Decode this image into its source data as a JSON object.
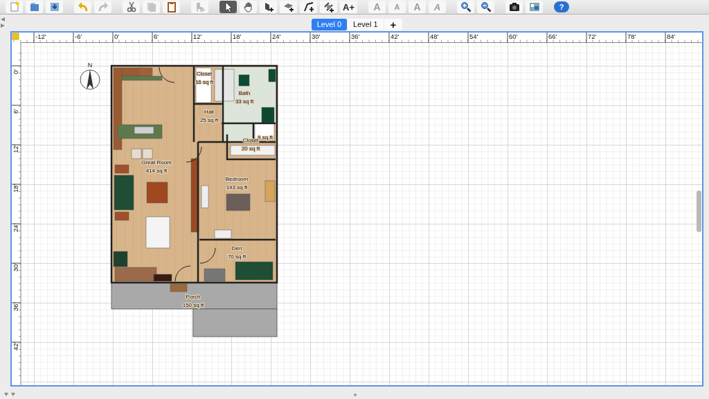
{
  "toolbar": {
    "groups": [
      {
        "buttons": [
          {
            "kind": "new",
            "disabled": false,
            "selected": false
          },
          {
            "kind": "open",
            "disabled": false,
            "selected": false
          },
          {
            "kind": "save",
            "disabled": false,
            "selected": false
          }
        ]
      },
      {
        "buttons": [
          {
            "kind": "undo",
            "disabled": false,
            "selected": false
          },
          {
            "kind": "redo",
            "disabled": true,
            "selected": false
          }
        ]
      },
      {
        "buttons": [
          {
            "kind": "cut",
            "disabled": false,
            "selected": false
          },
          {
            "kind": "copy",
            "disabled": true,
            "selected": false
          },
          {
            "kind": "paste",
            "disabled": false,
            "selected": false
          }
        ]
      },
      {
        "buttons": [
          {
            "kind": "add-furniture",
            "disabled": true,
            "selected": false
          }
        ]
      },
      {
        "buttons": [
          {
            "kind": "select",
            "disabled": false,
            "selected": true
          },
          {
            "kind": "pan",
            "disabled": false,
            "selected": false
          },
          {
            "kind": "walls",
            "disabled": false,
            "selected": false
          },
          {
            "kind": "rooms",
            "disabled": false,
            "selected": false
          },
          {
            "kind": "polylines",
            "disabled": false,
            "selected": false
          },
          {
            "kind": "dimensions",
            "disabled": false,
            "selected": false
          },
          {
            "kind": "add-text",
            "label": "A+",
            "disabled": false,
            "selected": false
          }
        ]
      },
      {
        "buttons": [
          {
            "kind": "bigger-text",
            "label": "A",
            "disabled": true,
            "selected": false
          },
          {
            "kind": "smaller-text",
            "label": "A",
            "disabled": true,
            "selected": false
          },
          {
            "kind": "bold-text",
            "label": "A",
            "disabled": true,
            "selected": false
          },
          {
            "kind": "italic-text",
            "label": "A",
            "disabled": true,
            "selected": false
          }
        ]
      },
      {
        "buttons": [
          {
            "kind": "zoom-in",
            "disabled": false,
            "selected": false
          },
          {
            "kind": "zoom-out",
            "disabled": false,
            "selected": false
          }
        ]
      },
      {
        "buttons": [
          {
            "kind": "photo",
            "disabled": false,
            "selected": false
          },
          {
            "kind": "video",
            "disabled": false,
            "selected": false
          }
        ]
      },
      {
        "buttons": [
          {
            "kind": "help",
            "label": "?",
            "disabled": false,
            "selected": false
          }
        ]
      }
    ]
  },
  "tabs": [
    {
      "label": "Level 0",
      "selected": true
    },
    {
      "label": "Level 1",
      "selected": false
    }
  ],
  "add_level": "+",
  "plan": {
    "ruler_x": [
      "-12'",
      "-6'",
      "0'",
      "6'",
      "12'",
      "18'",
      "24'",
      "30'",
      "36'",
      "42'",
      "48'",
      "54'",
      "60'",
      "66'",
      "72'",
      "78'",
      "84'"
    ],
    "ruler_y": [
      "0'",
      "6'",
      "12'",
      "18'",
      "24'",
      "30'",
      "36'",
      "42'"
    ],
    "compass": "N",
    "rooms": [
      {
        "name": "Great Room",
        "area": "414 sq ft"
      },
      {
        "name": "Closet",
        "area": "16 sq ft"
      },
      {
        "name": "Bath",
        "area": "33 sq ft"
      },
      {
        "name": "Hall",
        "area": "25 sq ft"
      },
      {
        "area": "8 sq ft"
      },
      {
        "name": "Closet",
        "area": "20 sq ft"
      },
      {
        "name": "Bedroom",
        "area": "143 sq ft"
      },
      {
        "name": "Den",
        "area": "70 sq ft"
      },
      {
        "name": "Porch",
        "area": "150 sq ft"
      }
    ]
  }
}
